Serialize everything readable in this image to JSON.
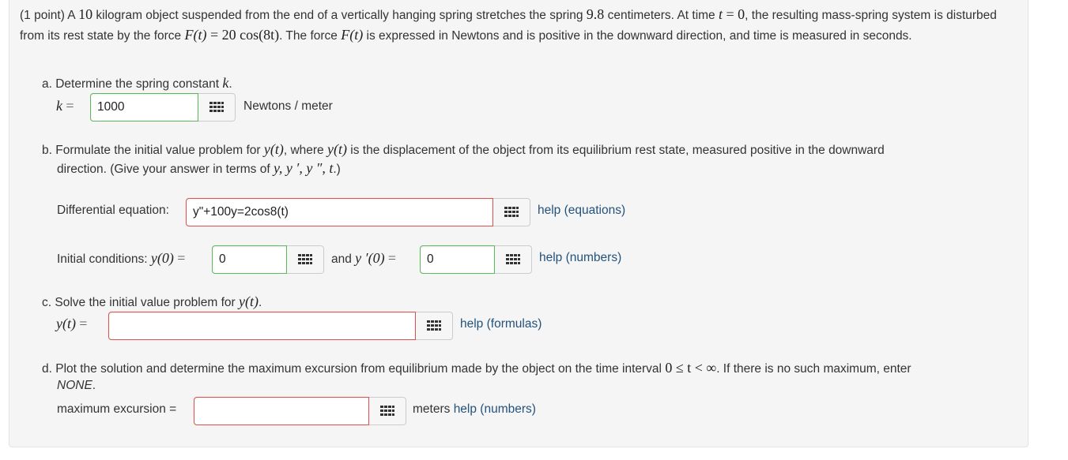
{
  "intro": {
    "t1": "(1 point) A ",
    "mass": "10",
    "t2": " kilogram object suspended from the end of a vertically hanging spring stretches the spring ",
    "stretch": "9.8",
    "t3": " centimeters. At time ",
    "t_var": "t",
    "t_eq": " = ",
    "t_zero": "0",
    "t4": ", the resulting mass-spring system is disturbed from its rest state by the force ",
    "force_lhs": "F(t)",
    "force_eq": " = ",
    "force_rhs": "20 cos(8t)",
    "t5": ". The force ",
    "force_name": "F(t)",
    "t6": " is expressed in Newtons and is positive in the downward direction, and time is measured in seconds."
  },
  "part_a": {
    "prompt": "a. Determine the spring constant ",
    "prompt_var": "k",
    "prompt_end": ".",
    "lhs": "k",
    "eq": "=",
    "value": "1000",
    "units": "Newtons / meter"
  },
  "part_b": {
    "p1": "b. Formulate the initial value problem for ",
    "p1_var": "y(t)",
    "p2": ", where ",
    "p2_var": "y(t)",
    "p3": " is the displacement of the object from its equilibrium rest state, measured positive in the downward",
    "p4": "direction. (Give your answer in terms of ",
    "p4_vars": "y, y ′, y ″, t",
    "p4_end": ".)",
    "de_label": "Differential equation:",
    "de_value": "y\"+100y=2cos8(t)",
    "help_equations": "help (equations)",
    "ic_label": "Initial conditions: ",
    "ic_y0": "y(0)",
    "ic_eq": "=",
    "ic_y0_value": "0",
    "and_label": "and ",
    "ic_yp0": "y ′(0)",
    "ic_yp0_value": "0",
    "help_numbers": "help (numbers)"
  },
  "part_c": {
    "prompt": "c. Solve the initial value problem for ",
    "prompt_var": "y(t)",
    "prompt_end": ".",
    "lhs": "y(t)",
    "eq": "=",
    "value": "",
    "help_formulas": "help (formulas)"
  },
  "part_d": {
    "p1": "d. Plot the solution and determine the maximum excursion from equilibrium made by the object on the time interval ",
    "interval": "0 ≤ t < ∞",
    "p2": ". If there is no such maximum, enter",
    "none": "NONE",
    "none_end": ".",
    "label": "maximum excursion =",
    "value": "",
    "units": "meters",
    "help_numbers": "help (numbers)"
  },
  "colors": {
    "panel_bg": "#f5f5f5",
    "correct_border": "#5cb85c",
    "incorrect_border": "#d9534f",
    "link": "#23527c"
  },
  "icons": {
    "editor_button": "grid-icon"
  }
}
